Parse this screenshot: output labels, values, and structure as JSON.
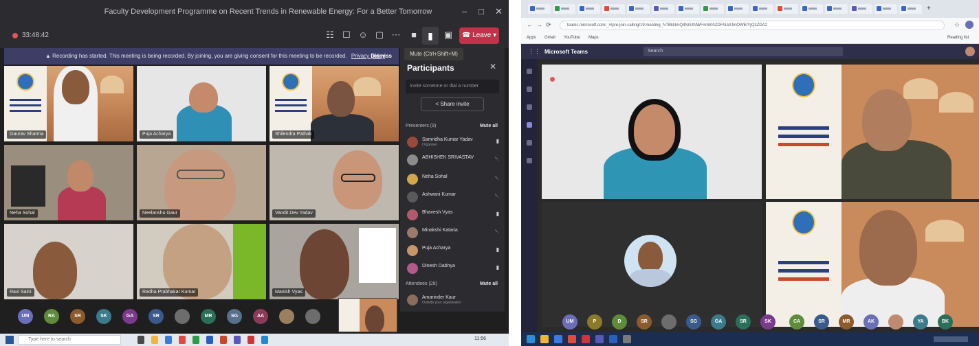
{
  "left": {
    "window_title": "Faculty Development Programme on Recent Trends in Renewable Energy: For a Better Tomorrow",
    "timer": "33:48:42",
    "leave_label": "Leave",
    "mic_tooltip": "Mute (Ctrl+Shift+M)",
    "banner": {
      "text": "Recording has started. This meeting is being recorded. By joining, you are giving consent for this meeting to be recorded.",
      "link": "Privacy policy",
      "dismiss": "Dismiss"
    },
    "tiles": [
      {
        "name": "Gaurav Sharma"
      },
      {
        "name": "Puja Acharya"
      },
      {
        "name": "Shilendra Pathak"
      },
      {
        "name": "Neha Sohal"
      },
      {
        "name": "Neelanshu Gaur"
      },
      {
        "name": "Vandit Dev Yadav"
      },
      {
        "name": "Ravi Saini"
      },
      {
        "name": "Radha Prabhakar Kumar"
      },
      {
        "name": "Manish Vyas"
      }
    ],
    "sidebar": {
      "title": "Participants",
      "search_placeholder": "Invite someone or dial a number",
      "share_invite": "Share invite",
      "presenters_label": "Presenters (9)",
      "mute_all": "Mute all",
      "attendees_label": "Attendees (28)",
      "participants": [
        {
          "name": "Samridha Kumar Yadav",
          "role": "Organiser"
        },
        {
          "name": "ABHISHEK SRIVASTAV",
          "role": ""
        },
        {
          "name": "Neha Sohal",
          "role": ""
        },
        {
          "name": "Ashwani Kumar",
          "role": ""
        },
        {
          "name": "Bhavesh Vyas",
          "role": ""
        },
        {
          "name": "Minakshi Kataria",
          "role": ""
        },
        {
          "name": "Puja Acharya",
          "role": ""
        },
        {
          "name": "Dinesh Dabhya",
          "role": ""
        },
        {
          "name": "Amarinder Kaur",
          "role": "Outside your organisation"
        }
      ]
    },
    "avatars": [
      {
        "initials": "UM",
        "color": "#6b6fb7"
      },
      {
        "initials": "RA",
        "color": "#5e8c3a"
      },
      {
        "initials": "SR",
        "color": "#8c5a2b"
      },
      {
        "initials": "SK",
        "color": "#3a7c8c"
      },
      {
        "initials": "GA",
        "color": "#7c3a8c"
      },
      {
        "initials": "SR",
        "color": "#3a5a8c"
      },
      {
        "initials": "",
        "color": "#6d6d6d"
      },
      {
        "initials": "MR",
        "color": "#2b6f5a"
      },
      {
        "initials": "SG",
        "color": "#5a6f8c"
      },
      {
        "initials": "AA",
        "color": "#8c3a5a"
      },
      {
        "initials": "",
        "color": "#9a8060"
      },
      {
        "initials": "",
        "color": "#6d6d6d"
      }
    ],
    "taskbar_search": "Type here to search",
    "clock": "11:56"
  },
  "right": {
    "url": "teams.microsoft.com/_#/pre-join-calling/19:meeting_NTBkNmQ4NGItNWFmNi00ZDFhLWJmOWEtYjQ3ZDA2",
    "bookmarks": [
      "Apps",
      "Gmail",
      "YouTube",
      "Maps"
    ],
    "reading_list": "Reading list",
    "teams_title": "Microsoft Teams",
    "search_placeholder": "Search",
    "avatars": [
      {
        "initials": "UM",
        "color": "#6b6fb7"
      },
      {
        "initials": "P",
        "color": "#8c7a2b"
      },
      {
        "initials": "D",
        "color": "#5e8c3a"
      },
      {
        "initials": "SR",
        "color": "#8c5a2b"
      },
      {
        "initials": "",
        "color": "#6d6d6d"
      },
      {
        "initials": "SG",
        "color": "#3a5a8c"
      },
      {
        "initials": "GA",
        "color": "#3a7c8c"
      },
      {
        "initials": "SR",
        "color": "#2b6f5a"
      },
      {
        "initials": "SK",
        "color": "#7c3a8c"
      }
    ],
    "avatars2": [
      {
        "initials": "CA",
        "color": "#5e8c3a"
      },
      {
        "initials": "SR",
        "color": "#3a5a8c"
      },
      {
        "initials": "MR",
        "color": "#8c5a2b"
      },
      {
        "initials": "AK",
        "color": "#6b6fb7"
      },
      {
        "initials": "",
        "color": "#c08a70"
      },
      {
        "initials": "YA",
        "color": "#3a7c8c"
      },
      {
        "initials": "BK",
        "color": "#2b6f5a"
      }
    ]
  }
}
